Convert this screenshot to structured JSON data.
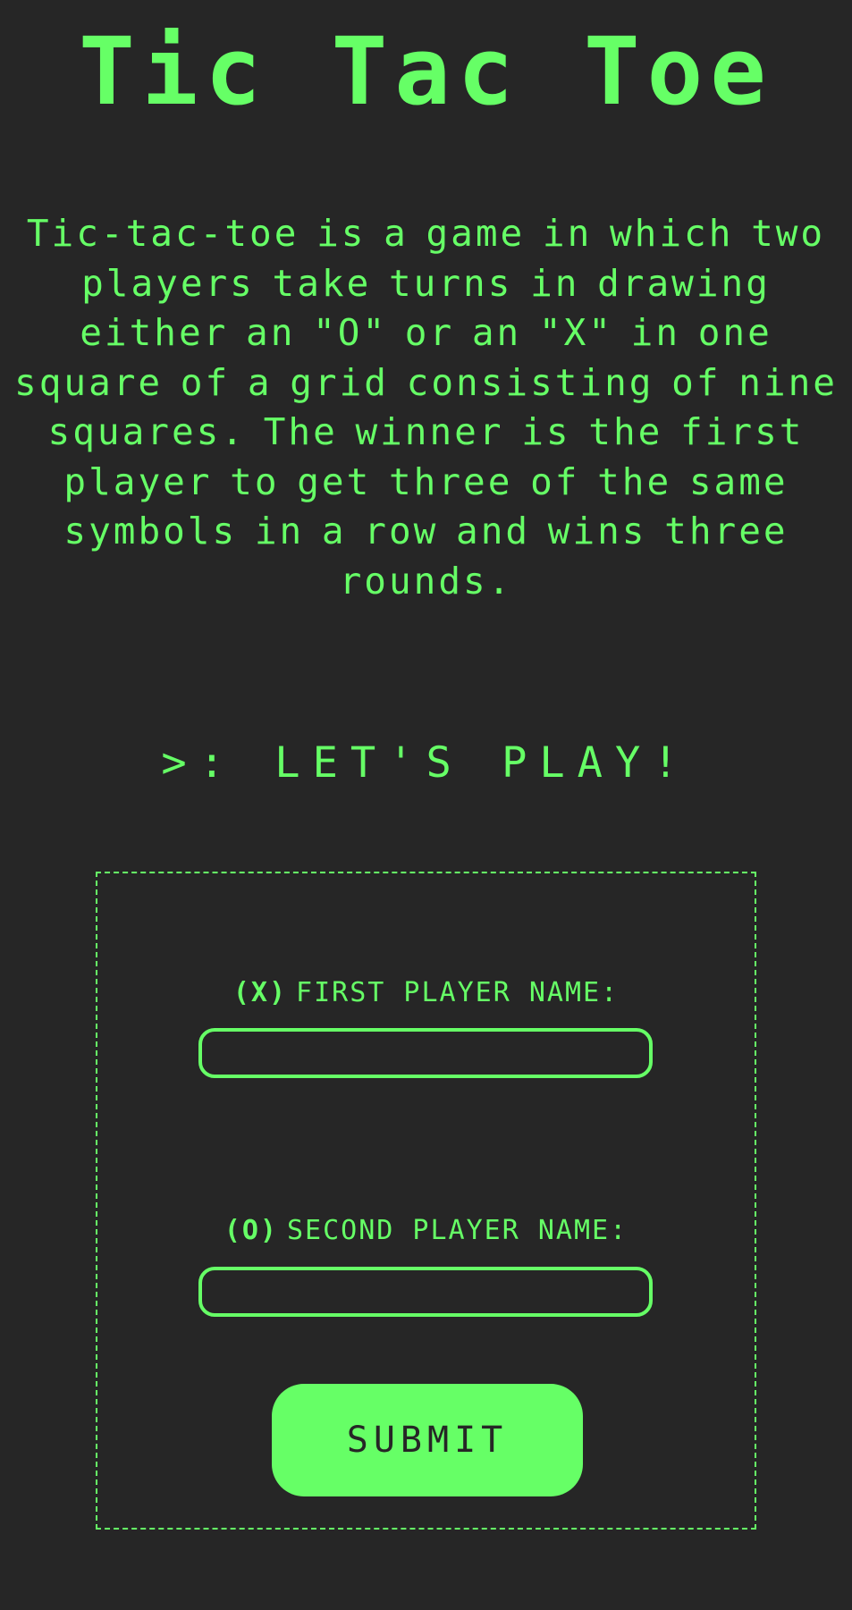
{
  "title": "Tic Tac Toe",
  "description": "Tic-tac-toe is a game in which two players take turns in drawing either an \"O\" or an \"X\" in one square of a grid consisting of nine squares. The winner is the first player to get three of the same symbols in a row and wins three rounds.",
  "cta": ">: LET'S PLAY!",
  "form": {
    "player1": {
      "mark": "(X)",
      "label": "FIRST PLAYER NAME:",
      "value": "",
      "placeholder": ""
    },
    "player2": {
      "mark": "(O)",
      "label": "SECOND PLAYER NAME:",
      "value": "",
      "placeholder": ""
    },
    "submit_label": "SUBMIT"
  },
  "colors": {
    "background": "#262626",
    "accent": "#66ff66"
  }
}
